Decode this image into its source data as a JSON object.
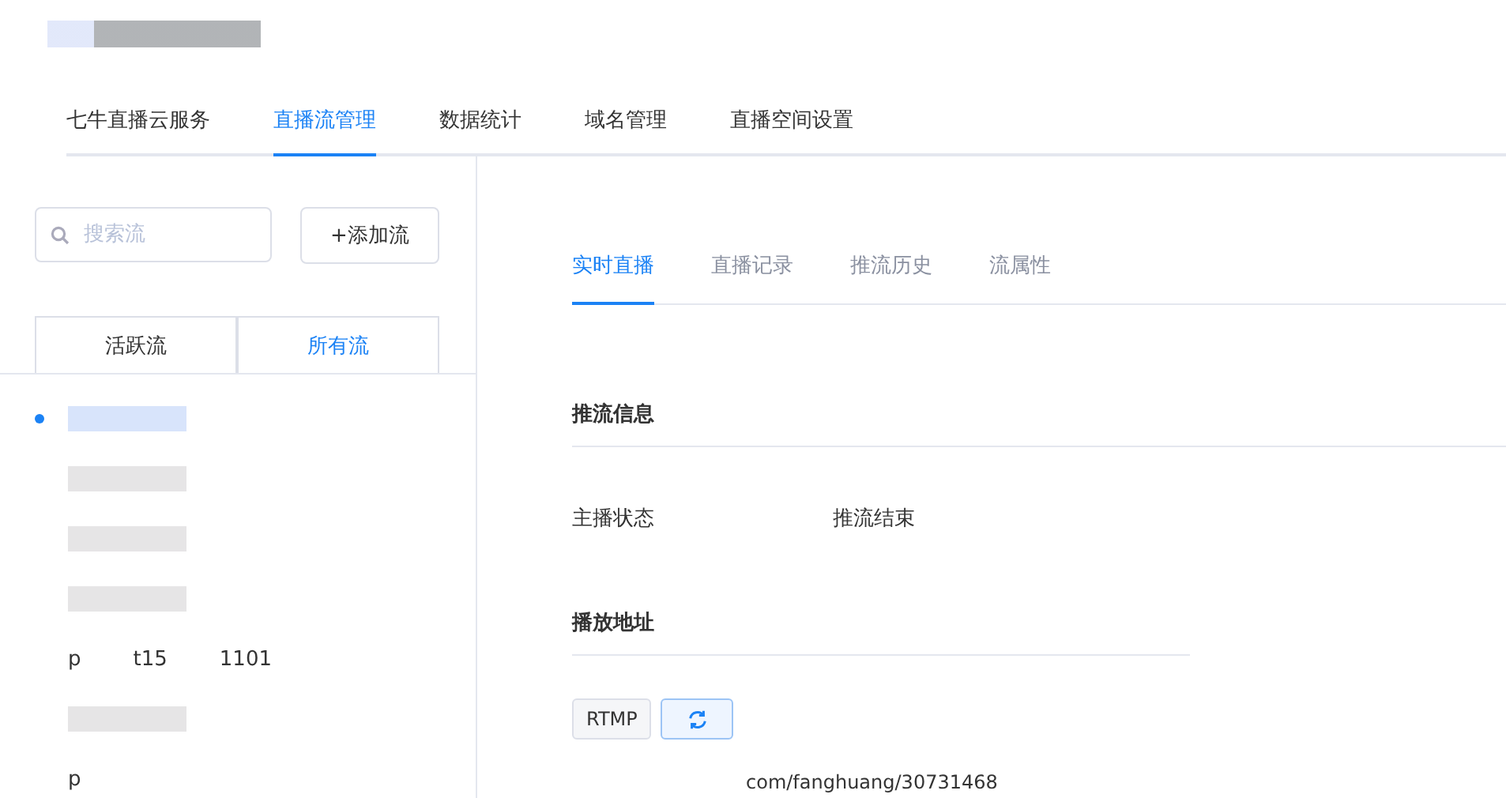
{
  "nav": [
    {
      "label": "七牛直播云服务",
      "selected": false
    },
    {
      "label": "直播流管理",
      "selected": true
    },
    {
      "label": "数据统计",
      "selected": false
    },
    {
      "label": "域名管理",
      "selected": false
    },
    {
      "label": "直播空间设置",
      "selected": false
    }
  ],
  "search": {
    "placeholder": "搜索流"
  },
  "add_button": "+添加流",
  "stream_tabs": [
    {
      "label": "活跃流",
      "selected": false
    },
    {
      "label": "所有流",
      "selected": true
    }
  ],
  "streams": [
    {
      "kind": "redacted",
      "selected": true
    },
    {
      "kind": "redacted",
      "selected": false
    },
    {
      "kind": "redacted",
      "selected": false
    },
    {
      "kind": "redacted",
      "selected": false
    },
    {
      "kind": "partial",
      "parts": [
        "p",
        "t15",
        "1101"
      ],
      "selected": false
    },
    {
      "kind": "redacted",
      "selected": false
    },
    {
      "kind": "partial",
      "parts": [
        "p"
      ],
      "selected": false
    }
  ],
  "detail_tabs": [
    {
      "label": "实时直播",
      "selected": true
    },
    {
      "label": "直播记录",
      "selected": false
    },
    {
      "label": "推流历史",
      "selected": false
    },
    {
      "label": "流属性",
      "selected": false
    }
  ],
  "push_info": {
    "title": "推流信息",
    "rows": [
      {
        "label": "主播状态",
        "value": "推流结束"
      }
    ]
  },
  "play_url": {
    "title": "播放地址",
    "protocol": "RTMP",
    "url_tail": "com/fanghuang/30731468"
  }
}
